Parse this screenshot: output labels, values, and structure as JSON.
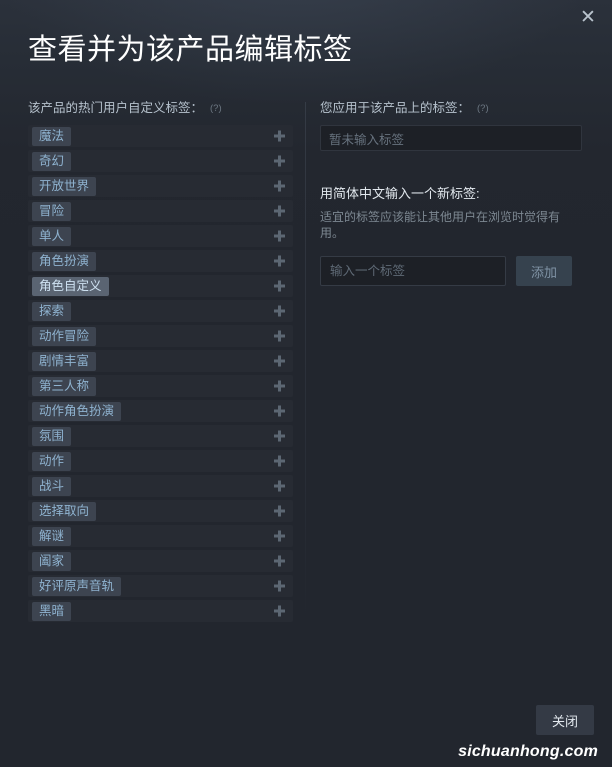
{
  "dialog": {
    "title": "查看并为该产品编辑标签",
    "close_icon_label": "✕"
  },
  "left_panel": {
    "label": "该产品的热门用户自定义标签：",
    "help_hint": "(?)",
    "add_icon_name": "plus-icon",
    "tags": [
      "魔法",
      "奇幻",
      "开放世界",
      "冒险",
      "单人",
      "角色扮演",
      "角色自定义",
      "探索",
      "动作冒险",
      "剧情丰富",
      "第三人称",
      "动作角色扮演",
      "氛围",
      "动作",
      "战斗",
      "选择取向",
      "解谜",
      "阖家",
      "好评原声音轨",
      "黑暗"
    ],
    "hovered_tag_index": 6
  },
  "right_panel": {
    "applied_label": "您应用于该产品上的标签：",
    "applied_help_hint": "(?)",
    "applied_empty_text": "暂未输入标签",
    "new_tag_heading": "用简体中文输入一个新标签:",
    "new_tag_description": "适宜的标签应该能让其他用户在浏览时觉得有用。",
    "new_tag_input_value": "",
    "new_tag_input_placeholder": "输入一个标签",
    "add_button_label": "添加"
  },
  "footer": {
    "close_button_label": "关闭"
  },
  "watermark": {
    "text": "sichuanhong.com"
  },
  "colors": {
    "background": "#22262e",
    "row_background": "#272b33",
    "pill_background": "#3d4450",
    "pill_text": "#8fb3d0",
    "pill_hover_background": "#5a6472",
    "accent_button": "#36424e",
    "title_text": "#ffffff"
  }
}
